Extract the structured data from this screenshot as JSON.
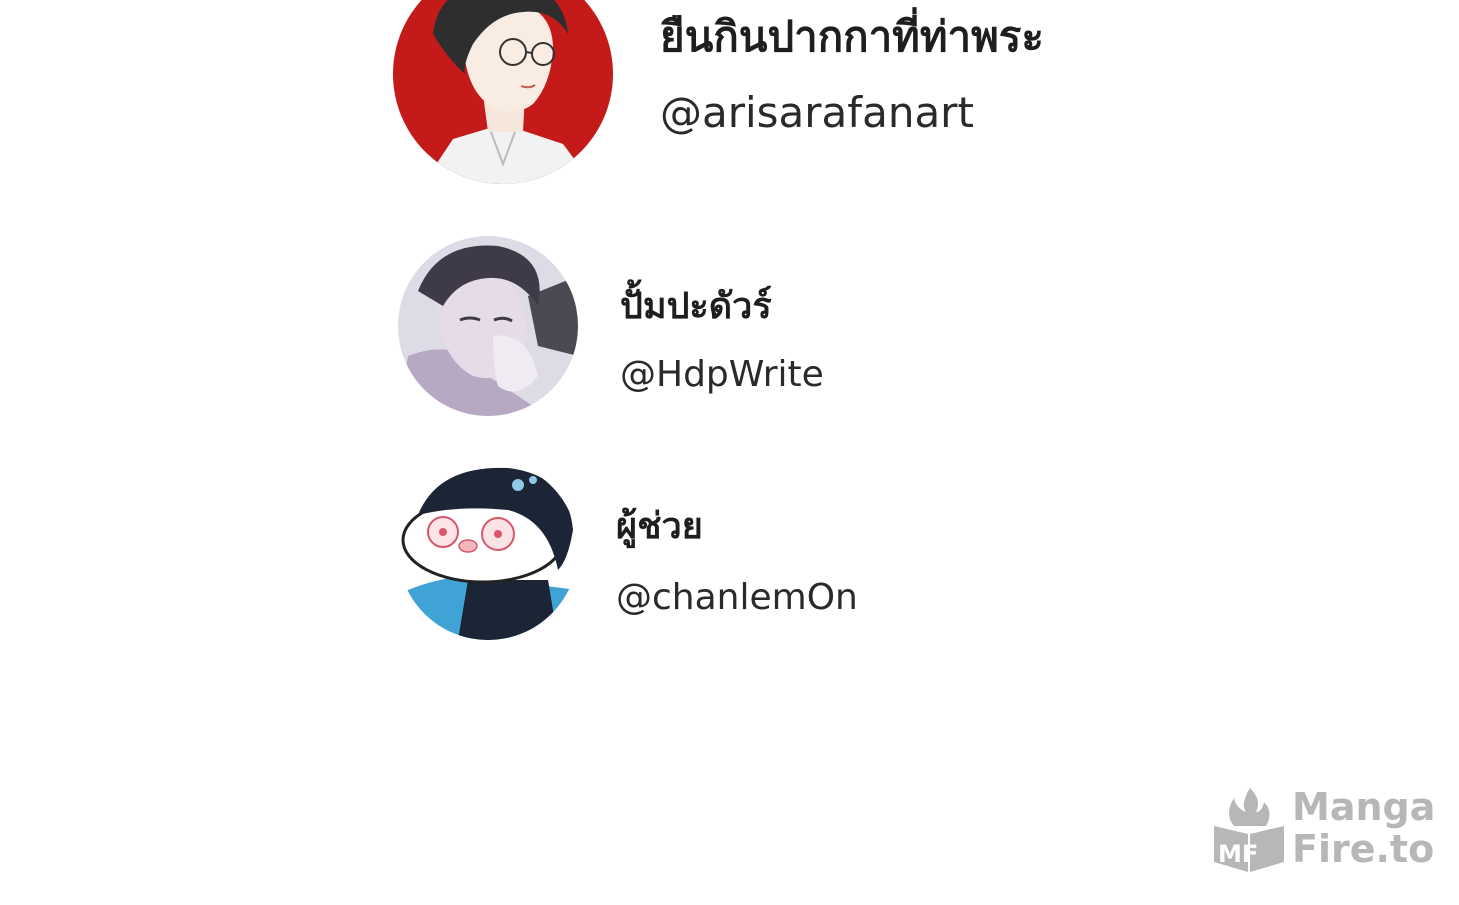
{
  "credits": [
    {
      "name": "ยืนกินปากกาที่ท่าพระ",
      "handle": "@arisarafanart",
      "avatar_color": "#c41a1a"
    },
    {
      "name": "ปั้มปะดัวร์",
      "handle": "@HdpWrite",
      "avatar_color": "#9a8fa8"
    },
    {
      "name": "ผู้ช่วย",
      "handle": "@chanlemOn",
      "avatar_color": "#3fa3d6"
    }
  ],
  "watermark": {
    "line1": "Manga",
    "line2": "Fire.to",
    "logo_letters": "MF",
    "color": "#b7b7b7"
  }
}
